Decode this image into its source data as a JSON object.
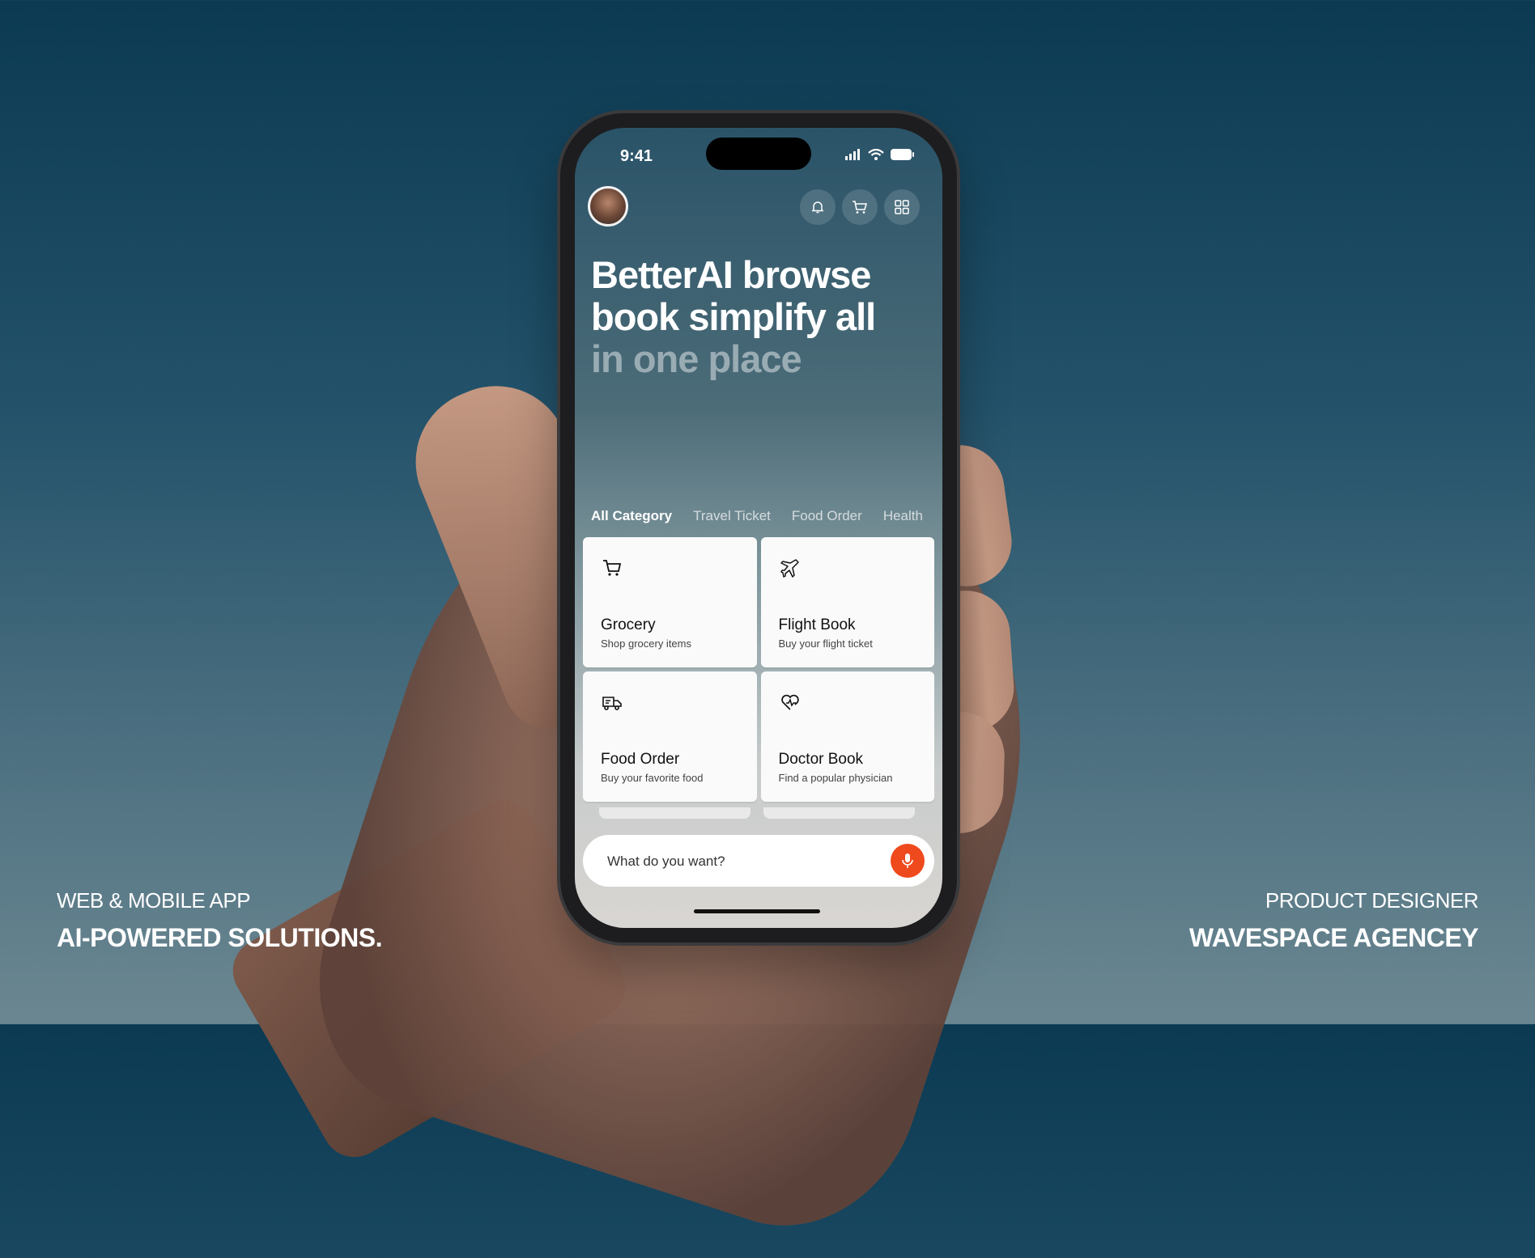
{
  "status_bar": {
    "time": "9:41"
  },
  "header": {
    "icons": [
      "bell-icon",
      "cart-icon",
      "grid-icon"
    ]
  },
  "headline": {
    "line1": "BetterAI browse",
    "line2": "book simplify all",
    "line3": "in one place"
  },
  "tabs": [
    {
      "label": "All Category",
      "active": true
    },
    {
      "label": "Travel Ticket",
      "active": false
    },
    {
      "label": "Food Order",
      "active": false
    },
    {
      "label": "Health",
      "active": false
    }
  ],
  "cards": [
    {
      "icon": "cart-icon",
      "title": "Grocery",
      "subtitle": "Shop grocery items"
    },
    {
      "icon": "airplane-icon",
      "title": "Flight Book",
      "subtitle": "Buy your flight ticket"
    },
    {
      "icon": "delivery-truck-icon",
      "title": "Food Order",
      "subtitle": "Buy your favorite food"
    },
    {
      "icon": "heart-pulse-icon",
      "title": "Doctor Book",
      "subtitle": "Find a popular physician"
    }
  ],
  "search": {
    "placeholder": "What do you want?"
  },
  "colors": {
    "accent": "#ef4a1d"
  },
  "captions": {
    "left_small": "WEB & MOBILE APP",
    "left_big": "AI-POWERED SOLUTIONS.",
    "right_small": "PRODUCT DESIGNER",
    "right_big": "WAVESPACE AGENCEY"
  }
}
